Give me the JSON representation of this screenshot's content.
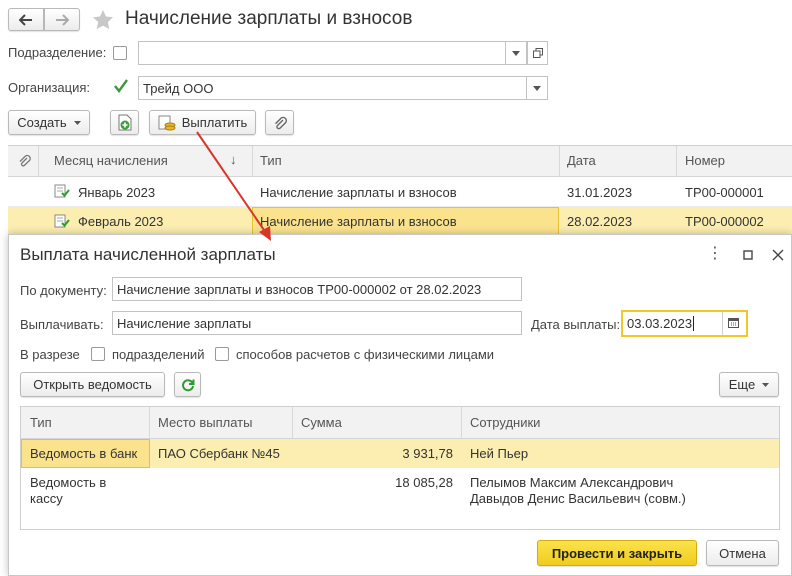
{
  "window": {
    "title": "Начисление зарплаты и взносов",
    "subdivision_label": "Подразделение:",
    "subdivision_value": "",
    "organization_label": "Организация:",
    "organization_value": "Трейд ООО",
    "create_label": "Создать",
    "pay_label": "Выплатить",
    "columns": [
      "Месяц начисления",
      "Тип",
      "Дата",
      "Номер"
    ],
    "rows": [
      {
        "month": "Январь 2023",
        "type": "Начисление зарплаты и взносов",
        "date": "31.01.2023",
        "number": "ТР00-000001",
        "selected": false
      },
      {
        "month": "Февраль 2023",
        "type": "Начисление зарплаты и взносов",
        "date": "28.02.2023",
        "number": "ТР00-000002",
        "selected": true
      }
    ]
  },
  "dialog": {
    "title": "Выплата начисленной зарплаты",
    "doc_label": "По документу:",
    "doc_value": "Начисление зарплаты и взносов ТР00-000002 от 28.02.2023",
    "pay_label": "Выплачивать:",
    "pay_value": "Начисление зарплаты",
    "date_label": "Дата выплаты:",
    "date_value": "03.03.2023",
    "section_label": "В разрезе",
    "subdiv_check_label": "подразделений",
    "methods_check_label": "способов расчетов с физическими лицами",
    "open_statement_label": "Открыть ведомость",
    "more_label": "Еще",
    "columns": [
      "Тип",
      "Место выплаты",
      "Сумма",
      "Сотрудники"
    ],
    "rows": [
      {
        "type": "Ведомость в банк",
        "place": "ПАО Сбербанк №45",
        "sum": "3 931,78",
        "employees": [
          "Ней Пьер"
        ],
        "selected": true
      },
      {
        "type": "Ведомость в кассу",
        "place": "",
        "sum": "18 085,28",
        "employees": [
          "Пелымов Максим Александрович",
          "Давыдов Денис Васильевич (совм.)"
        ],
        "selected": false
      }
    ],
    "submit_label": "Провести и закрыть",
    "cancel_label": "Отмена"
  },
  "colors": {
    "accent_yellow": "#f5d22e",
    "selected_row": "#fbeeb0",
    "arrow_red": "#d9362b",
    "check_green": "#3b9a3b"
  }
}
